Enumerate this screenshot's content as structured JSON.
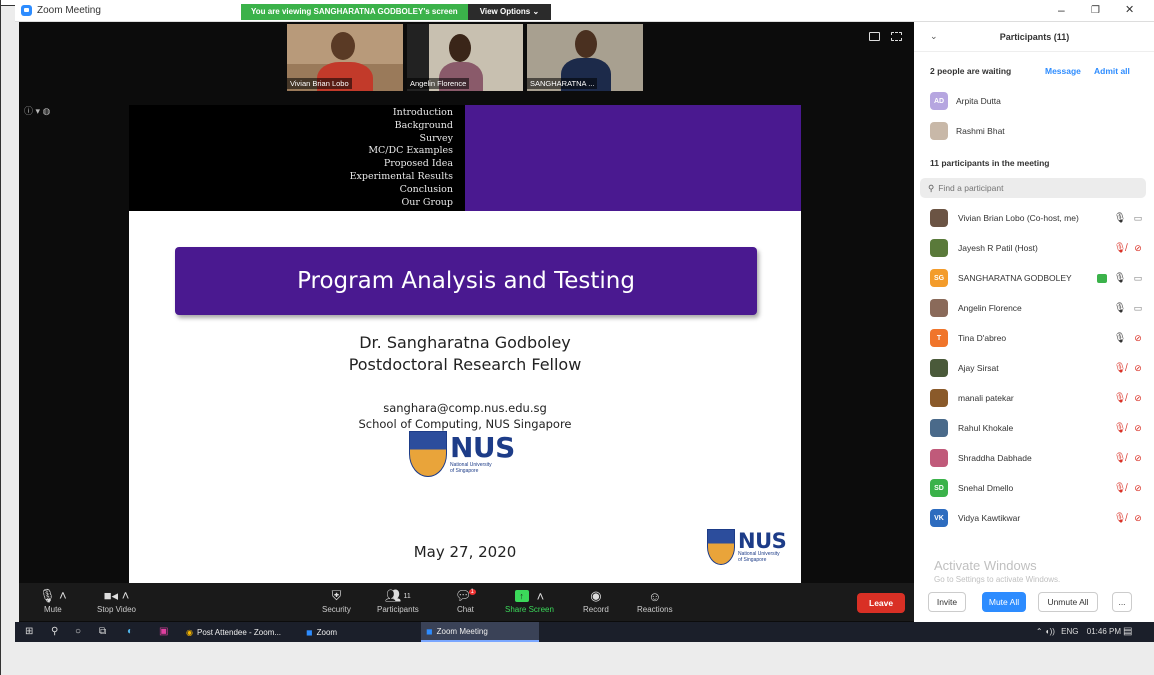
{
  "window": {
    "title": "Zoom Meeting",
    "banner_text": "You are viewing SANGHARATNA GODBOLEY's screen",
    "view_options": "View Options ⌄",
    "min": "–",
    "max": "❐",
    "close": "✕"
  },
  "thumbnails": [
    {
      "name": "Vivian Brian Lobo"
    },
    {
      "name": "Angelin Florence"
    },
    {
      "name": "SANGHARATNA ..."
    }
  ],
  "slide": {
    "nav": [
      "Introduction",
      "Background",
      "Survey",
      "MC/DC Examples",
      "Proposed Idea",
      "Experimental Results",
      "Conclusion",
      "Our Group"
    ],
    "title": "Program Analysis and Testing",
    "author": "Dr. Sangharatna Godboley",
    "position": "Postdoctoral Research Fellow",
    "email": "sanghara@comp.nus.edu.sg",
    "school": "School of Computing, NUS Singapore",
    "logo_text": "NUS",
    "logo_sub1": "National University",
    "logo_sub2": "of Singapore",
    "date": "May 27, 2020"
  },
  "controls": {
    "mute": "Mute",
    "stop_video": "Stop Video",
    "security": "Security",
    "participants": "Participants",
    "participants_count": "11",
    "chat": "Chat",
    "chat_badge": "1",
    "share_screen": "Share Screen",
    "record": "Record",
    "reactions": "Reactions",
    "leave": "Leave"
  },
  "panel": {
    "title": "Participants (11)",
    "waiting_text": "2 people are waiting",
    "message": "Message",
    "admit_all": "Admit all",
    "waiting": [
      {
        "initials": "AD",
        "name": "Arpita Dutta",
        "color": "#b6a6e0"
      },
      {
        "initials": "",
        "name": "Rashmi Bhat",
        "color": "#c8b8a8"
      }
    ],
    "in_meeting_text": "11 participants in the meeting",
    "search_placeholder": "Find a participant",
    "participants": [
      {
        "initials": "",
        "name": "Vivian Brian Lobo (Co-host, me)",
        "color": "#6b5444",
        "mic": "on",
        "cam": "on"
      },
      {
        "initials": "",
        "name": "Jayesh R Patil (Host)",
        "color": "#5a7a3a",
        "mic": "muted",
        "cam": "off"
      },
      {
        "initials": "SG",
        "name": "SANGHARATNA GODBOLEY",
        "color": "#f39c2b",
        "mic": "on",
        "cam": "on",
        "sharing": true
      },
      {
        "initials": "",
        "name": "Angelin Florence",
        "color": "#8a6a5a",
        "mic": "on",
        "cam": "on"
      },
      {
        "initials": "T",
        "name": "Tina D'abreo",
        "color": "#f0752b",
        "mic": "on",
        "cam": "off"
      },
      {
        "initials": "",
        "name": "Ajay Sirsat",
        "color": "#4a5a3a",
        "mic": "muted",
        "cam": "off"
      },
      {
        "initials": "",
        "name": "manali patekar",
        "color": "#8a5a2a",
        "mic": "muted",
        "cam": "off"
      },
      {
        "initials": "",
        "name": "Rahul Khokale",
        "color": "#4a6a8a",
        "mic": "muted",
        "cam": "off"
      },
      {
        "initials": "",
        "name": "Shraddha Dabhade",
        "color": "#c05a7a",
        "mic": "muted",
        "cam": "off"
      },
      {
        "initials": "SD",
        "name": "Snehal Dmello",
        "color": "#3bb24a",
        "mic": "muted",
        "cam": "off"
      },
      {
        "initials": "VK",
        "name": "Vidya Kawtikwar",
        "color": "#2d6cbf",
        "mic": "muted",
        "cam": "off"
      }
    ],
    "activate_title": "Activate Windows",
    "activate_sub": "Go to Settings to activate Windows.",
    "invite": "Invite",
    "mute_all": "Mute All",
    "unmute_all": "Unmute All",
    "more": "..."
  },
  "taskbar": {
    "item1": "Post Attendee - Zoom...",
    "item2": "Zoom",
    "item3": "Zoom Meeting",
    "lang": "ENG",
    "time": "01:46 PM"
  }
}
